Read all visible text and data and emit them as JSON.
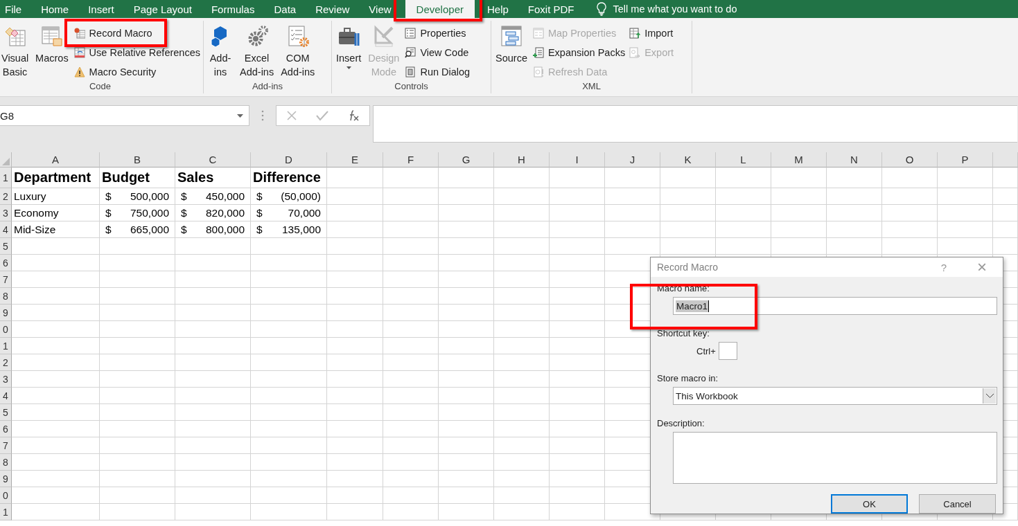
{
  "tabs": [
    {
      "label": "File",
      "selected": false
    },
    {
      "label": "Home",
      "selected": false
    },
    {
      "label": "Insert",
      "selected": false
    },
    {
      "label": "Page Layout",
      "selected": false
    },
    {
      "label": "Formulas",
      "selected": false
    },
    {
      "label": "Data",
      "selected": false
    },
    {
      "label": "Review",
      "selected": false
    },
    {
      "label": "View",
      "selected": false
    },
    {
      "label": "Developer",
      "selected": true
    },
    {
      "label": "Help",
      "selected": false
    },
    {
      "label": "Foxit PDF",
      "selected": false
    }
  ],
  "tell_me": "Tell me what you want to do",
  "ribbon": {
    "groups": [
      {
        "label": "Code",
        "controls": [
          {
            "kind": "big",
            "label": "Visual\nBasic",
            "disabled": false,
            "dropdown": false
          },
          {
            "kind": "big",
            "label": "Macros",
            "disabled": false,
            "dropdown": false
          },
          {
            "kind": "stack",
            "buttons": [
              {
                "label": "Record Macro",
                "disabled": false
              },
              {
                "label": "Use Relative References",
                "disabled": false
              },
              {
                "label": "Macro Security",
                "disabled": false
              }
            ]
          }
        ]
      },
      {
        "label": "Add-ins",
        "controls": [
          {
            "kind": "big",
            "label": "Add-\nins",
            "disabled": false,
            "dropdown": false
          },
          {
            "kind": "big",
            "label": "Excel\nAdd-ins",
            "disabled": false,
            "dropdown": false
          },
          {
            "kind": "big",
            "label": "COM\nAdd-ins",
            "disabled": false,
            "dropdown": false
          }
        ]
      },
      {
        "label": "Controls",
        "controls": [
          {
            "kind": "big",
            "label": "Insert",
            "disabled": false,
            "dropdown": true
          },
          {
            "kind": "big",
            "label": "Design\nMode",
            "disabled": true,
            "dropdown": false
          },
          {
            "kind": "stack",
            "buttons": [
              {
                "label": "Properties",
                "disabled": false
              },
              {
                "label": "View Code",
                "disabled": false
              },
              {
                "label": "Run Dialog",
                "disabled": false
              }
            ]
          }
        ]
      },
      {
        "label": "XML",
        "controls": [
          {
            "kind": "big",
            "label": "Source",
            "disabled": false,
            "dropdown": false
          },
          {
            "kind": "stack",
            "buttons": [
              {
                "label": "Map Properties",
                "disabled": true
              },
              {
                "label": "Expansion Packs",
                "disabled": false
              },
              {
                "label": "Refresh Data",
                "disabled": true
              }
            ]
          },
          {
            "kind": "stack",
            "buttons": [
              {
                "label": "Import",
                "disabled": false
              },
              {
                "label": "Export",
                "disabled": true
              }
            ]
          }
        ]
      }
    ]
  },
  "formula_bar": {
    "name_box": "G8"
  },
  "sheet": {
    "columns": [
      "A",
      "B",
      "C",
      "D",
      "E",
      "F",
      "G",
      "H",
      "I",
      "J",
      "K",
      "L",
      "M",
      "N",
      "O",
      "P"
    ],
    "rows": [
      {
        "number": "1",
        "cells": [
          {
            "kind": "header",
            "text": "Department"
          },
          {
            "kind": "header",
            "text": "Budget"
          },
          {
            "kind": "header",
            "text": "Sales"
          },
          {
            "kind": "header",
            "text": "Difference"
          }
        ]
      },
      {
        "number": "2",
        "cells": [
          {
            "kind": "text",
            "text": "Luxury"
          },
          {
            "kind": "currency",
            "symbol": "$",
            "amount": "500,000"
          },
          {
            "kind": "currency",
            "symbol": "$",
            "amount": "450,000"
          },
          {
            "kind": "currency",
            "symbol": "$",
            "amount": "(50,000)"
          }
        ]
      },
      {
        "number": "3",
        "cells": [
          {
            "kind": "text",
            "text": "Economy"
          },
          {
            "kind": "currency",
            "symbol": "$",
            "amount": "750,000"
          },
          {
            "kind": "currency",
            "symbol": "$",
            "amount": "820,000"
          },
          {
            "kind": "currency",
            "symbol": "$",
            "amount": "70,000"
          }
        ]
      },
      {
        "number": "4",
        "cells": [
          {
            "kind": "text",
            "text": "Mid-Size"
          },
          {
            "kind": "currency",
            "symbol": "$",
            "amount": "665,000"
          },
          {
            "kind": "currency",
            "symbol": "$",
            "amount": "800,000"
          },
          {
            "kind": "currency",
            "symbol": "$",
            "amount": "135,000"
          }
        ]
      },
      {
        "number": "5",
        "cells": []
      },
      {
        "number": "6",
        "cells": []
      },
      {
        "number": "7",
        "cells": []
      },
      {
        "number": "8",
        "cells": []
      },
      {
        "number": "9",
        "cells": []
      },
      {
        "number": "0",
        "cells": []
      },
      {
        "number": "1",
        "cells": []
      },
      {
        "number": "2",
        "cells": []
      },
      {
        "number": "3",
        "cells": []
      },
      {
        "number": "4",
        "cells": []
      },
      {
        "number": "5",
        "cells": []
      },
      {
        "number": "6",
        "cells": []
      },
      {
        "number": "7",
        "cells": []
      },
      {
        "number": "8",
        "cells": []
      },
      {
        "number": "9",
        "cells": []
      },
      {
        "number": "0",
        "cells": []
      },
      {
        "number": "1",
        "cells": []
      }
    ]
  },
  "dialog": {
    "title": "Record Macro",
    "active": false,
    "help": "?",
    "close": "×",
    "macro_name_label": "Macro name:",
    "macro_name": "Macro1",
    "macro_name_selected": true,
    "shortcut_label": "Shortcut key:",
    "ctrl_label": "Ctrl+",
    "store_label": "Store macro in:",
    "store_value": "This Workbook",
    "description_label": "Description:",
    "buttons": [
      {
        "label": "OK",
        "default": true
      },
      {
        "label": "Cancel",
        "default": false
      }
    ]
  }
}
